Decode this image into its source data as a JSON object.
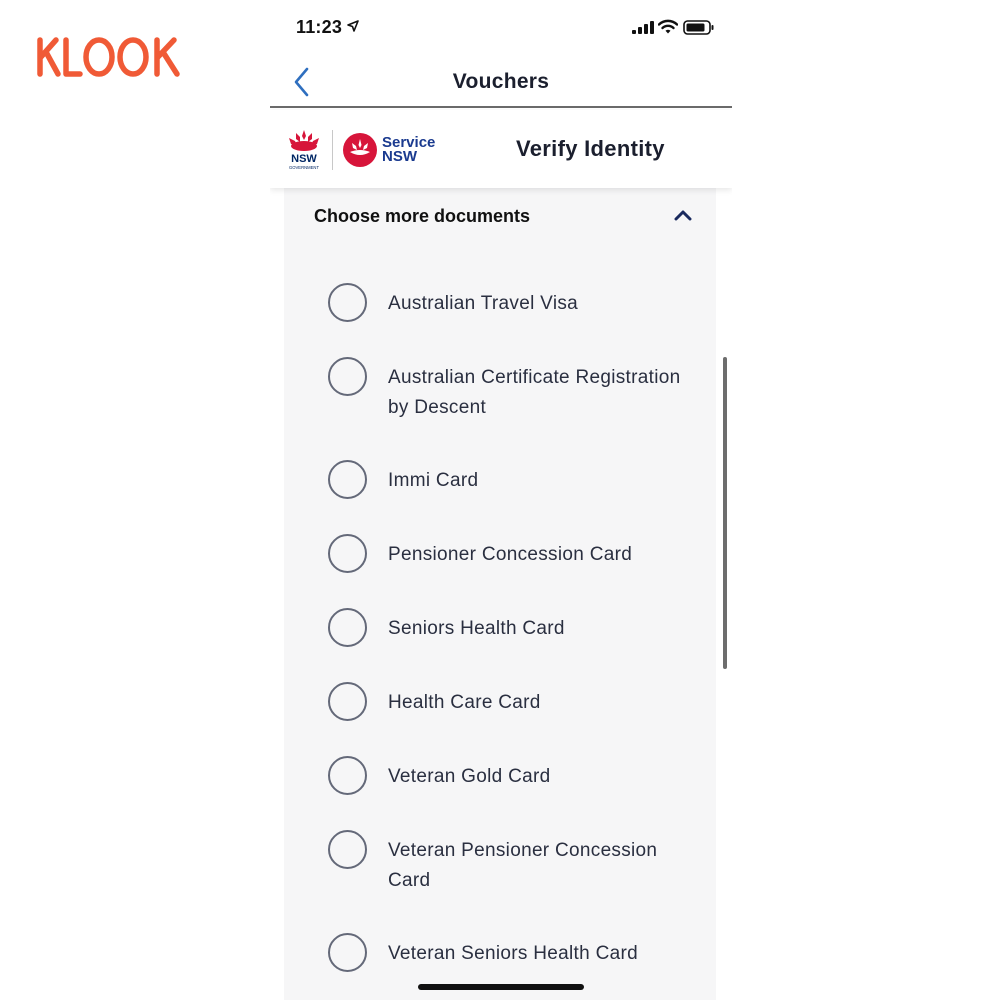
{
  "brand": {
    "logo_text": "KLOOK",
    "logo_color": "#f05a36"
  },
  "status_bar": {
    "time": "11:23",
    "icons": [
      "location-arrow-icon",
      "cellular-signal-icon",
      "wifi-icon",
      "battery-icon"
    ]
  },
  "nav": {
    "back_icon": "chevron-left-icon",
    "title": "Vouchers",
    "accent_color": "#2f6fbf"
  },
  "header": {
    "gov_logo_text": "NSW",
    "gov_logo_subtext": "GOVERNMENT",
    "service_logo_line1": "Service",
    "service_logo_line2": "NSW",
    "title": "Verify Identity"
  },
  "documents": {
    "section_title": "Choose more documents",
    "toggle_icon": "chevron-up-icon",
    "items": [
      {
        "label": "Australian Travel Visa",
        "selected": false
      },
      {
        "label": "Australian Certificate Registration by Descent",
        "selected": false
      },
      {
        "label": "Immi Card",
        "selected": false
      },
      {
        "label": "Pensioner Concession Card",
        "selected": false
      },
      {
        "label": "Seniors Health Card",
        "selected": false
      },
      {
        "label": "Health Care Card",
        "selected": false
      },
      {
        "label": "Veteran Gold Card",
        "selected": false
      },
      {
        "label": "Veteran Pensioner Concession Card",
        "selected": false
      },
      {
        "label": "Veteran Seniors Health Card",
        "selected": false
      }
    ]
  }
}
